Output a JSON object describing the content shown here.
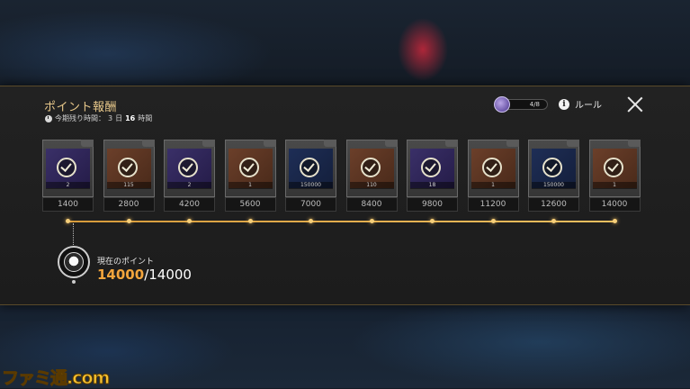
{
  "header": {
    "title": "ポイント報酬",
    "period_label": "今期残り時間：",
    "period_days": "3",
    "period_days_unit": "日",
    "period_hours": "16",
    "period_hours_unit": "時間"
  },
  "counter": {
    "value": "4/8",
    "icon": "token-coin-icon"
  },
  "rule_button": {
    "label": "ルール",
    "icon": "info-icon"
  },
  "close_button": {
    "icon": "close-icon"
  },
  "rewards": [
    {
      "quantity": "2",
      "cost": "1400",
      "claimed": true,
      "color": "purple"
    },
    {
      "quantity": "115",
      "cost": "2800",
      "claimed": true,
      "color": "orange"
    },
    {
      "quantity": "2",
      "cost": "4200",
      "claimed": true,
      "color": "purple"
    },
    {
      "quantity": "1",
      "cost": "5600",
      "claimed": true,
      "color": "orange"
    },
    {
      "quantity": "150000",
      "cost": "7000",
      "claimed": true,
      "color": "blue"
    },
    {
      "quantity": "110",
      "cost": "8400",
      "claimed": true,
      "color": "orange"
    },
    {
      "quantity": "18",
      "cost": "9800",
      "claimed": true,
      "color": "purple"
    },
    {
      "quantity": "1",
      "cost": "11200",
      "claimed": true,
      "color": "orange"
    },
    {
      "quantity": "150000",
      "cost": "12600",
      "claimed": true,
      "color": "blue"
    },
    {
      "quantity": "1",
      "cost": "14000",
      "claimed": true,
      "color": "orange"
    }
  ],
  "current_points": {
    "label": "現在のポイント",
    "value": "14000",
    "separator": "/",
    "max": "14000"
  },
  "watermark": "ファミ通.com",
  "colors": {
    "accent_gold": "#e9c98b",
    "points_orange": "#f3a53c",
    "track": "#f0c060"
  }
}
